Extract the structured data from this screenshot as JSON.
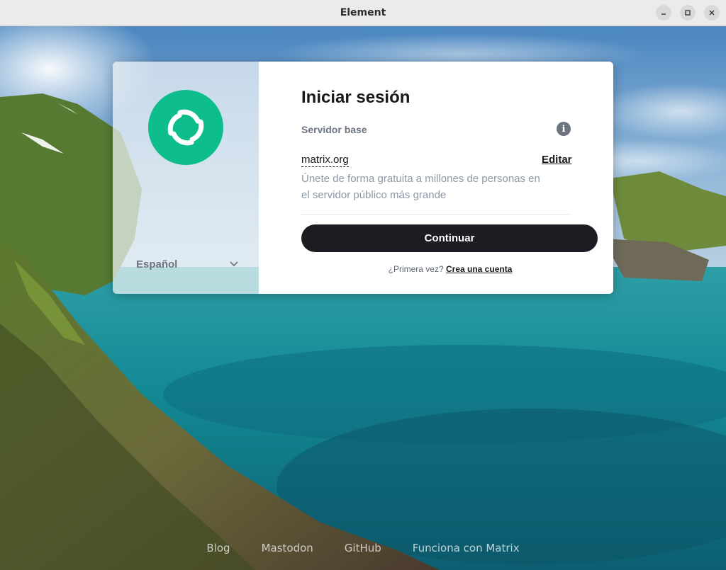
{
  "window": {
    "title": "Element"
  },
  "login": {
    "heading": "Iniciar sesión",
    "server_label": "Servidor base",
    "server_name": "matrix.org",
    "edit_label": "Editar",
    "server_description": "Únete de forma gratuita a millones de personas en el servidor público más grande",
    "continue_label": "Continuar",
    "first_time_text": "¿Primera vez?",
    "create_account_label": "Crea una cuenta"
  },
  "language": {
    "selected": "Español"
  },
  "footer": {
    "links": [
      "Blog",
      "Mastodon",
      "GitHub",
      "Funciona con Matrix"
    ]
  },
  "colors": {
    "brand": "#0dbd8b",
    "button": "#1b1d22"
  }
}
